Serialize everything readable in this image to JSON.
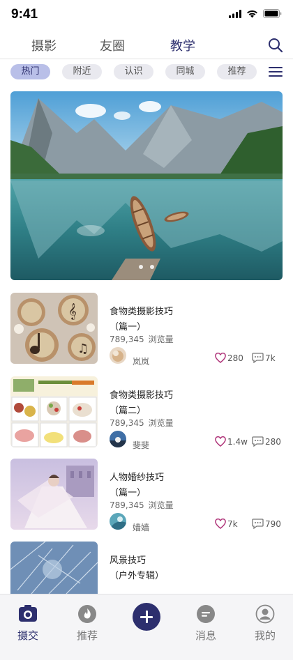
{
  "status_bar": {
    "time": "9:41"
  },
  "top_tabs": [
    {
      "label": "摄影"
    },
    {
      "label": "友圈"
    },
    {
      "label": "教学",
      "active": true
    }
  ],
  "chips": [
    {
      "label": "热门",
      "active": true
    },
    {
      "label": "附近"
    },
    {
      "label": "认识"
    },
    {
      "label": "同城"
    },
    {
      "label": "推荐"
    }
  ],
  "banner": {
    "slides": 2,
    "current": 1
  },
  "feed": [
    {
      "title_line1": "食物类摄影技巧",
      "title_line2": "（篇一）",
      "views": "789,345",
      "views_label": "浏览量",
      "author": "岚岚",
      "likes": "280",
      "comments": "7k"
    },
    {
      "title_line1": "食物类摄影技巧",
      "title_line2": "（篇二）",
      "views": "789,345",
      "views_label": "浏览量",
      "author": "斐斐",
      "likes": "1.4w",
      "comments": "280"
    },
    {
      "title_line1": "人物婚纱技巧",
      "title_line2": "（篇一）",
      "views": "789,345",
      "views_label": "浏览量",
      "author": "嫱嫱",
      "likes": "7k",
      "comments": "790"
    },
    {
      "title_line1": "风景技巧",
      "title_line2": "（户外专辑）"
    }
  ],
  "bottom_nav": [
    {
      "label": "摄交",
      "icon": "camera-icon",
      "active": true
    },
    {
      "label": "推荐",
      "icon": "flame-icon"
    },
    {
      "label": "",
      "icon": "plus-icon"
    },
    {
      "label": "消息",
      "icon": "message-icon"
    },
    {
      "label": "我的",
      "icon": "user-icon"
    }
  ],
  "colors": {
    "accent": "#2d2f6e",
    "chip_active": "#b9bfe8",
    "like": "#b0357a"
  }
}
